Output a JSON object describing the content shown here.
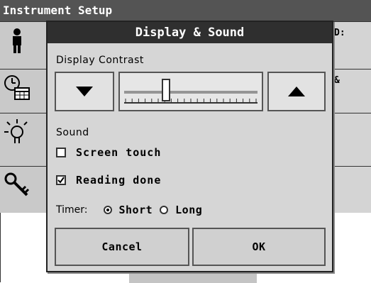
{
  "background": {
    "title": "Instrument Setup",
    "rows": [
      {
        "icon": "person-icon",
        "right_text": "D:"
      },
      {
        "icon": "clock-calendar-icon",
        "right_text": "&"
      },
      {
        "icon": "lamp-icon",
        "right_text": ""
      },
      {
        "icon": "key-icon",
        "right_text": ""
      }
    ]
  },
  "dialog": {
    "title": "Display & Sound",
    "contrast": {
      "label": "Display Contrast",
      "level": 0.3,
      "decrease_icon": "triangle-down-icon",
      "increase_icon": "triangle-up-icon"
    },
    "sound": {
      "label": "Sound",
      "screen_touch": {
        "label": "Screen touch",
        "checked": false
      },
      "reading_done": {
        "label": "Reading done",
        "checked": true
      },
      "timer": {
        "label": "Timer:",
        "options": [
          "Short",
          "Long"
        ],
        "selected": "Short"
      }
    },
    "buttons": {
      "cancel": "Cancel",
      "ok": "OK"
    }
  }
}
